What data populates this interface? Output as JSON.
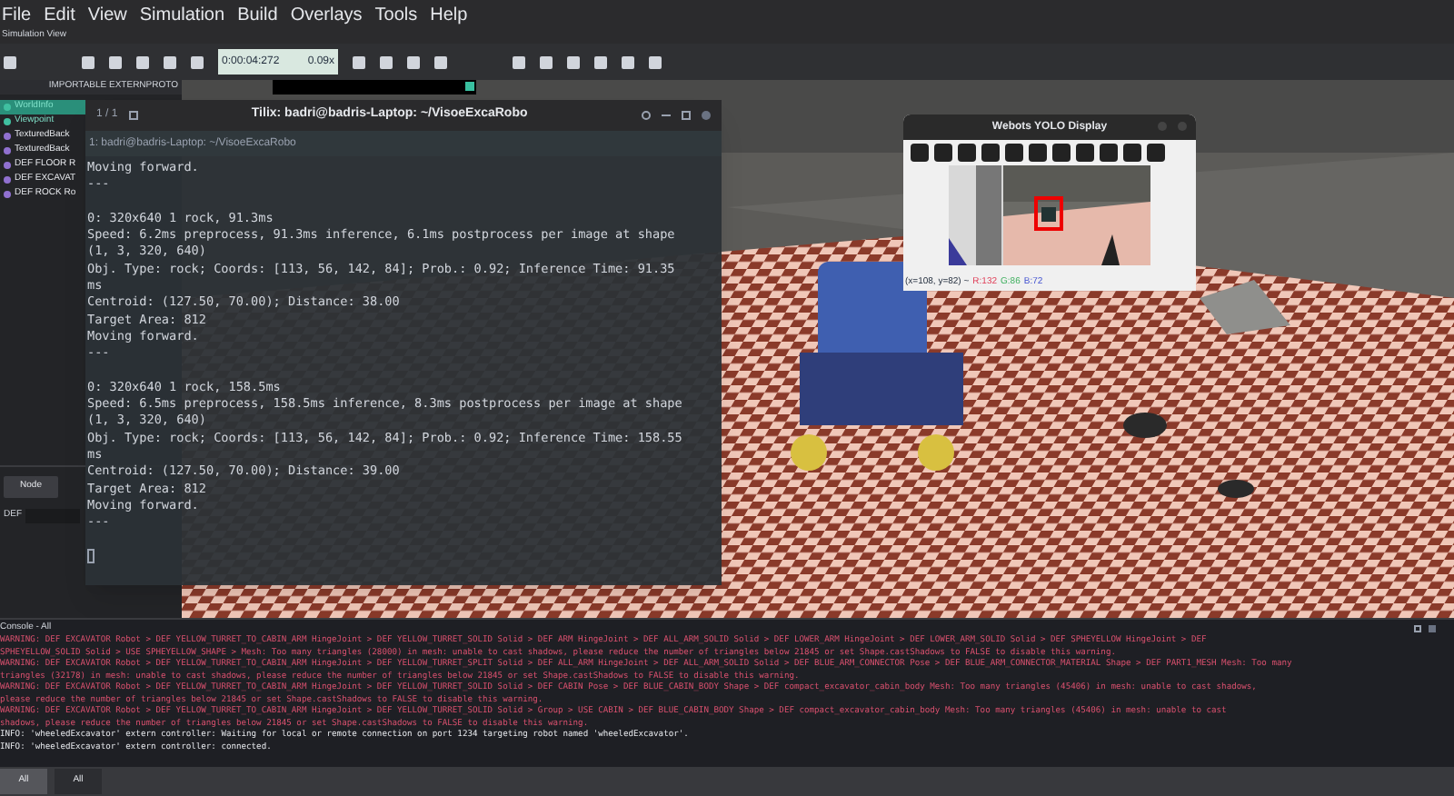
{
  "menu": [
    "File",
    "Edit",
    "View",
    "Simulation",
    "Build",
    "Overlays",
    "Tools",
    "Help"
  ],
  "view_label": "Simulation View",
  "toolbar": {
    "time": "0:00:04:272",
    "speed": "0.09x"
  },
  "scene_tree": {
    "header": "IMPORTABLE EXTERNPROTO",
    "items": [
      {
        "label": "WorldInfo",
        "selected": true
      },
      {
        "label": "Viewpoint",
        "selected": false
      },
      {
        "label": "TexturedBack",
        "selected": false
      },
      {
        "label": "TexturedBack",
        "selected": false
      },
      {
        "label": "DEF FLOOR R",
        "selected": false
      },
      {
        "label": "DEF EXCAVAT",
        "selected": false
      },
      {
        "label": "DEF ROCK Ro",
        "selected": false
      }
    ],
    "node_button": "Node",
    "def_label": "DEF"
  },
  "terminal": {
    "title": "Tilix: badri@badris-Laptop: ~/VisoeExcaRobo",
    "session": "1 / 1",
    "tab": "1: badri@badris-Laptop: ~/VisoeExcaRobo",
    "groups": [
      [
        "Moving forward.",
        "---"
      ],
      [
        "0: 320x640 1 rock, 91.3ms",
        "Speed: 6.2ms preprocess, 91.3ms inference, 6.1ms postprocess per image at shape",
        "(1, 3, 320, 640)",
        "Obj. Type: rock; Coords: [113, 56, 142, 84]; Prob.: 0.92; Inference Time: 91.35",
        "ms",
        "Centroid: (127.50, 70.00); Distance: 38.00",
        "Target Area: 812",
        "Moving forward.",
        "---"
      ],
      [
        "0: 320x640 1 rock, 158.5ms",
        "Speed: 6.5ms preprocess, 158.5ms inference, 8.3ms postprocess per image at shape",
        "(1, 3, 320, 640)",
        "Obj. Type: rock; Coords: [113, 56, 142, 84]; Prob.: 0.92; Inference Time: 158.55",
        "ms",
        "Centroid: (127.50, 70.00); Distance: 39.00",
        "Target Area: 812",
        "Moving forward.",
        "---"
      ]
    ]
  },
  "yolo_window": {
    "title": "Webots YOLO Display",
    "status": {
      "position": "(x=108, y=82) ~",
      "r": "R:132",
      "g": "G:86",
      "b": "B:72"
    }
  },
  "console": {
    "title": "Console - All",
    "lines": [
      {
        "kind": "warning",
        "text": "WARNING: DEF EXCAVATOR Robot > DEF YELLOW_TURRET_TO_CABIN_ARM HingeJoint > DEF YELLOW_TURRET_SOLID Solid > DEF ARM HingeJoint > DEF ALL_ARM_SOLID Solid > DEF LOWER_ARM HingeJoint > DEF LOWER_ARM_SOLID Solid > DEF SPHEYELLOW HingeJoint > DEF"
      },
      {
        "kind": "warning",
        "text": "SPHEYELLOW_SOLID Solid > USE SPHEYELLOW_SHAPE > Mesh: Too many triangles (28000) in mesh: unable to cast shadows, please reduce the number of triangles below 21845 or set Shape.castShadows to FALSE to disable this warning."
      },
      {
        "kind": "warning",
        "text": "WARNING: DEF EXCAVATOR Robot > DEF YELLOW_TURRET_TO_CABIN_ARM HingeJoint > DEF YELLOW_TURRET_SPLIT Solid > DEF ALL_ARM HingeJoint > DEF ALL_ARM_SOLID Solid > DEF BLUE_ARM_CONNECTOR Pose > DEF BLUE_ARM_CONNECTOR_MATERIAL Shape > DEF PART1_MESH Mesh: Too many"
      },
      {
        "kind": "warning",
        "text": "triangles (32178) in mesh: unable to cast shadows, please reduce the number of triangles below 21845 or set Shape.castShadows to FALSE to disable this warning."
      },
      {
        "kind": "warning",
        "text": "WARNING: DEF EXCAVATOR Robot > DEF YELLOW_TURRET_TO_CABIN_ARM HingeJoint > DEF YELLOW_TURRET_SOLID Solid > DEF CABIN Pose > DEF BLUE_CABIN_BODY Shape > DEF compact_excavator_cabin_body Mesh: Too many triangles (45406) in mesh: unable to cast shadows,"
      },
      {
        "kind": "warning",
        "text": "please reduce the number of triangles below 21845 or set Shape.castShadows to FALSE to disable this warning."
      },
      {
        "kind": "warning",
        "text": "WARNING: DEF EXCAVATOR Robot > DEF YELLOW_TURRET_TO_CABIN_ARM HingeJoint > DEF YELLOW_TURRET_SOLID Solid > Group > USE CABIN > DEF BLUE_CABIN_BODY Shape > DEF compact_excavator_cabin_body Mesh: Too many triangles (45406) in mesh: unable to cast"
      },
      {
        "kind": "warning",
        "text": "shadows, please reduce the number of triangles below 21845 or set Shape.castShadows to FALSE to disable this warning."
      },
      {
        "kind": "info",
        "text": "INFO: 'wheeledExcavator' extern controller: Waiting for local or remote connection on port 1234 targeting robot named 'wheeledExcavator'."
      },
      {
        "kind": "info",
        "text": "INFO: 'wheeledExcavator' extern controller: connected."
      }
    ]
  },
  "bottom_tabs": [
    {
      "label": "All",
      "selected": true
    },
    {
      "label": "All",
      "selected": false
    }
  ]
}
